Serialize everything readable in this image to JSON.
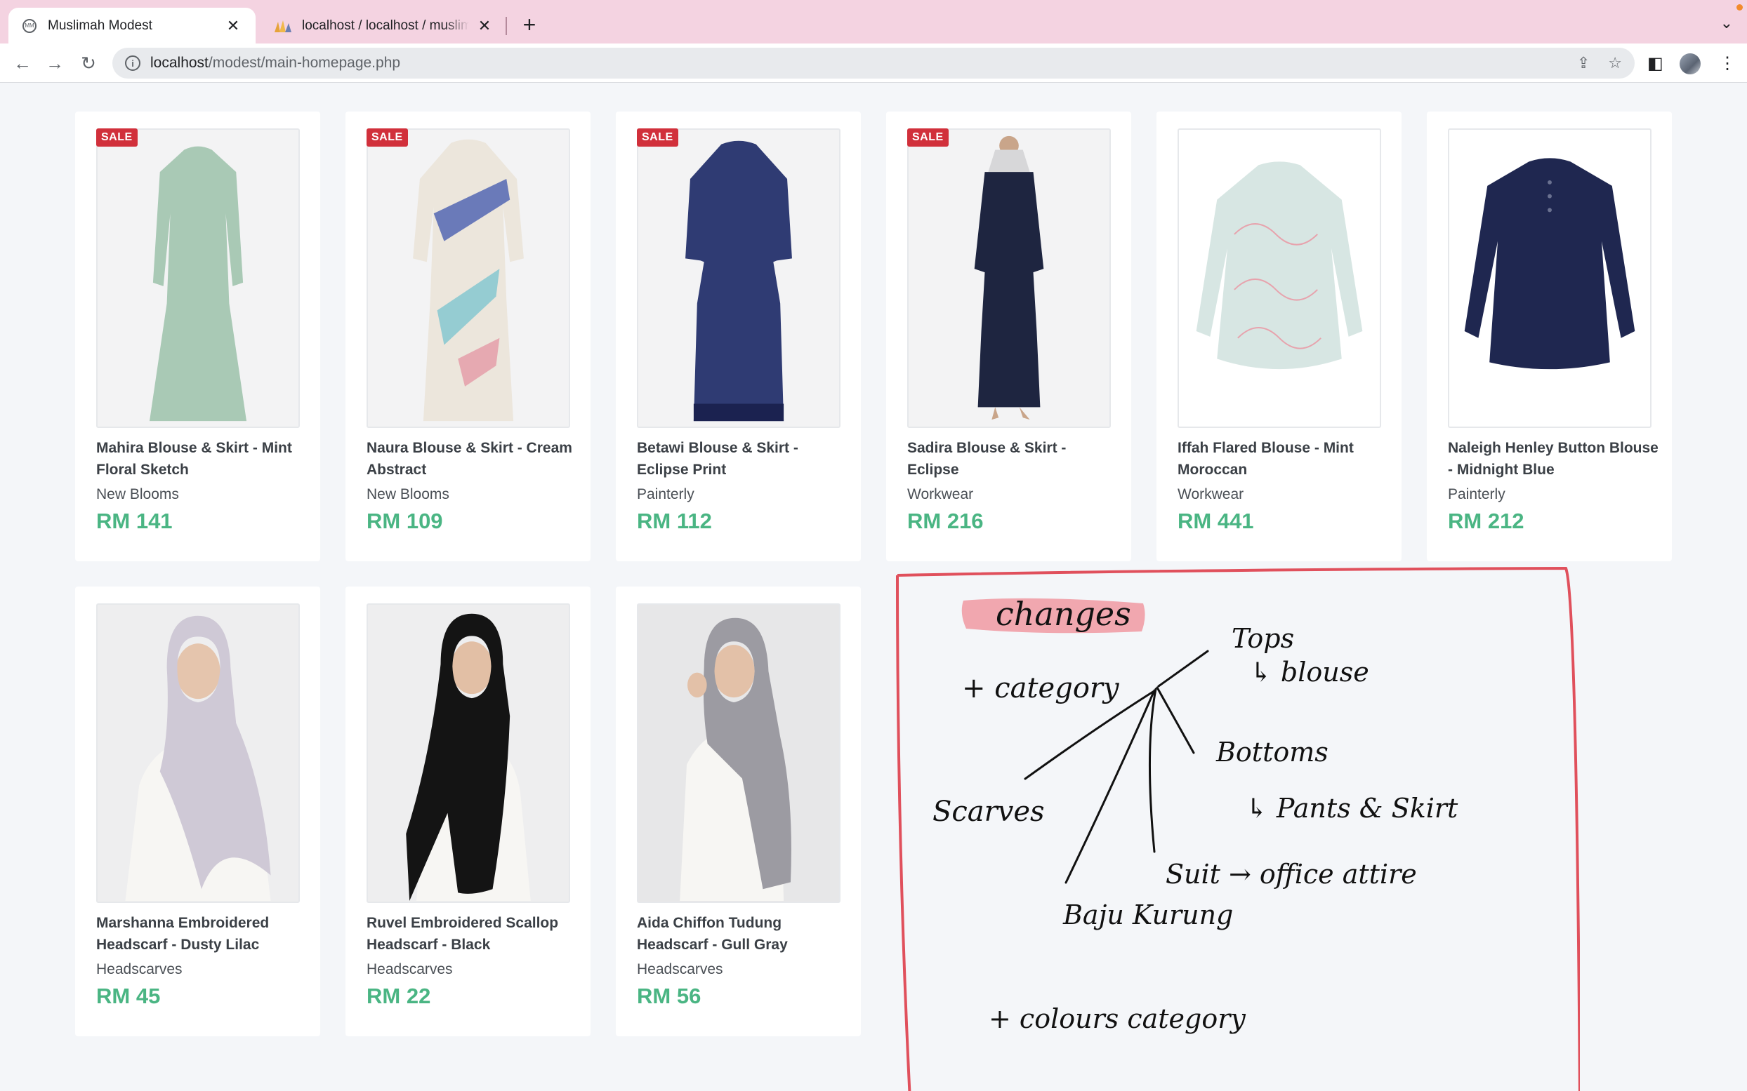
{
  "browser": {
    "tabs": [
      {
        "title": "Muslimah Modest",
        "active": true
      },
      {
        "title": "localhost / localhost / muslimah",
        "active": false
      }
    ],
    "url_host": "localhost",
    "url_path": "/modest/main-homepage.php"
  },
  "products": [
    {
      "name": "Mahira Blouse & Skirt - Mint Floral Sketch",
      "category": "New Blooms",
      "price": "RM 141",
      "badge": "SALE",
      "color": "#a9c9b5"
    },
    {
      "name": "Naura Blouse & Skirt - Cream Abstract",
      "category": "New Blooms",
      "price": "RM 109",
      "badge": "SALE",
      "color": "#ece6dc"
    },
    {
      "name": "Betawi Blouse & Skirt - Eclipse Print",
      "category": "Painterly",
      "price": "RM 112",
      "badge": "SALE",
      "color": "#2f3b73"
    },
    {
      "name": "Sadira Blouse & Skirt - Eclipse",
      "category": "Workwear",
      "price": "RM 216",
      "badge": "SALE",
      "color": "#1e2540"
    },
    {
      "name": "Iffah Flared Blouse - Mint Moroccan",
      "category": "Workwear",
      "price": "RM 441",
      "badge": "",
      "color": "#d7e6e3"
    },
    {
      "name": "Naleigh Henley Button Blouse - Midnight Blue",
      "category": "Painterly",
      "price": "RM 212",
      "badge": "",
      "color": "#1f2750"
    },
    {
      "name": "Marshanna Embroidered Headscarf - Dusty Lilac",
      "category": "Headscarves",
      "price": "RM 45",
      "badge": "",
      "color": "#cfc9d6"
    },
    {
      "name": "Ruvel Embroidered Scallop Headscarf - Black",
      "category": "Headscarves",
      "price": "RM 22",
      "badge": "",
      "color": "#141414"
    },
    {
      "name": "Aida Chiffon Tudung Headscarf - Gull Gray",
      "category": "Headscarves",
      "price": "RM 56",
      "badge": "",
      "color": "#9c9ba2"
    }
  ],
  "annotation": {
    "heading": "changes",
    "category_line": "+ category",
    "tops": "Tops",
    "blouse": "↳ blouse",
    "bottoms": "Bottoms",
    "pants_skirt": "↳ Pants & Skirt",
    "scarves": "Scarves",
    "suit": "Suit → office attire",
    "baju_kurung": "Baju Kurung",
    "colours_line": "+ colours category",
    "colors": {
      "ink": "#111111",
      "frame": "#e0505c",
      "highlight": "#f08c96"
    }
  }
}
